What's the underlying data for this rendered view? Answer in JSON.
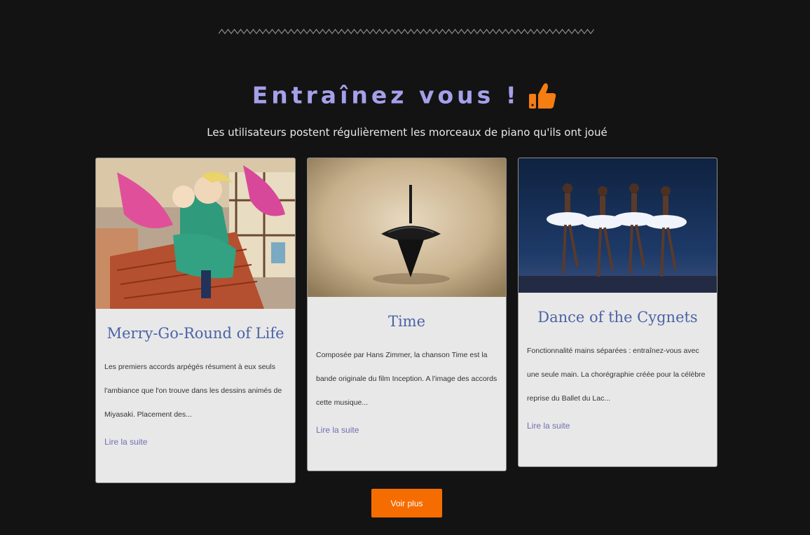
{
  "section": {
    "title": "Entraînez vous !",
    "subtitle": "Les utilisateurs postent régulièrement les morceaux de piano qu'ils ont joué"
  },
  "cards": [
    {
      "title": "Merry-Go-Round of Life",
      "excerpt": "Les premiers accords arpégés résument à eux seuls l'ambiance que l'on trouve dans les dessins animés de Miyasaki. Placement des...",
      "read_more": "Lire la suite"
    },
    {
      "title": "Time",
      "excerpt": "Composée par Hans Zimmer, la chanson Time est la bande originale du film Inception. A l'image des accords cette musique...",
      "read_more": "Lire la suite"
    },
    {
      "title": "Dance of the Cygnets",
      "excerpt": "Fonctionnalité mains séparées : entraînez-vous avec une seule main. La chorégraphie créée pour la célèbre reprise du Ballet du Lac...",
      "read_more": "Lire la suite"
    }
  ],
  "more_button": "Voir plus",
  "colors": {
    "background": "#131313",
    "title": "#a5a0ea",
    "accent": "#f56d00",
    "card_title": "#4a64a8",
    "link": "#6d6fb5"
  },
  "icons": {
    "title_icon": "thumbs-up-icon",
    "divider": "zigzag-divider"
  }
}
